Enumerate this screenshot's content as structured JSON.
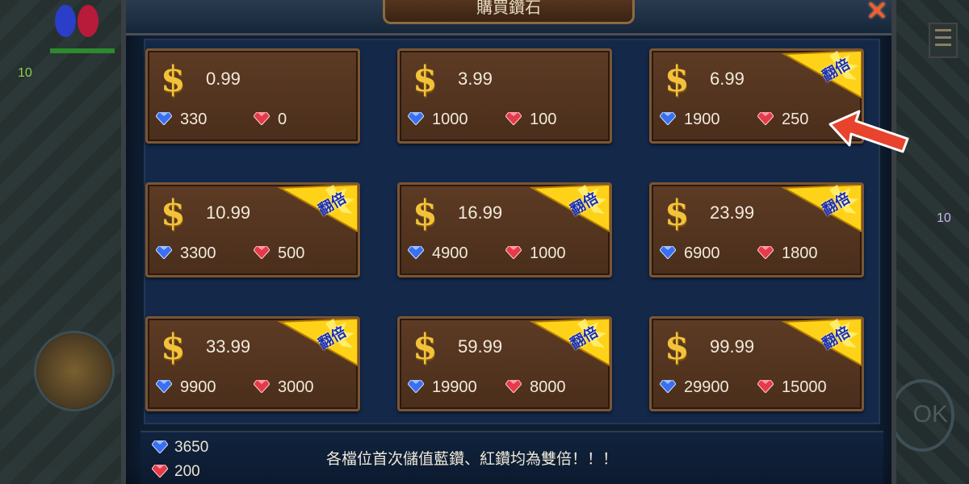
{
  "hud": {
    "level_value": "10",
    "side_count": "10",
    "ok_label": "OK"
  },
  "dialog": {
    "title": "購買鑽石",
    "close_label": "✕"
  },
  "colors": {
    "card_bg": "#5d3b24",
    "panel_bg": "#14294a",
    "gold": "#f3c23a",
    "blue_gem": "#3a6ff0",
    "red_gem": "#e53a4a",
    "badge": "#ffd21a"
  },
  "packages": [
    {
      "price": "0.99",
      "blue": "330",
      "red": "0",
      "double": false
    },
    {
      "price": "3.99",
      "blue": "1000",
      "red": "100",
      "double": false
    },
    {
      "price": "6.99",
      "blue": "1900",
      "red": "250",
      "double": true
    },
    {
      "price": "10.99",
      "blue": "3300",
      "red": "500",
      "double": true
    },
    {
      "price": "16.99",
      "blue": "4900",
      "red": "1000",
      "double": true
    },
    {
      "price": "23.99",
      "blue": "6900",
      "red": "1800",
      "double": true
    },
    {
      "price": "33.99",
      "blue": "9900",
      "red": "3000",
      "double": true
    },
    {
      "price": "59.99",
      "blue": "19900",
      "red": "8000",
      "double": true
    },
    {
      "price": "99.99",
      "blue": "29900",
      "red": "15000",
      "double": true
    }
  ],
  "currency_symbol": "$",
  "double_badge_text": "翻倍",
  "balance": {
    "blue": "3650",
    "red": "200"
  },
  "notice": "各檔位首次儲值藍鑽、紅鑽均為雙倍！！！"
}
